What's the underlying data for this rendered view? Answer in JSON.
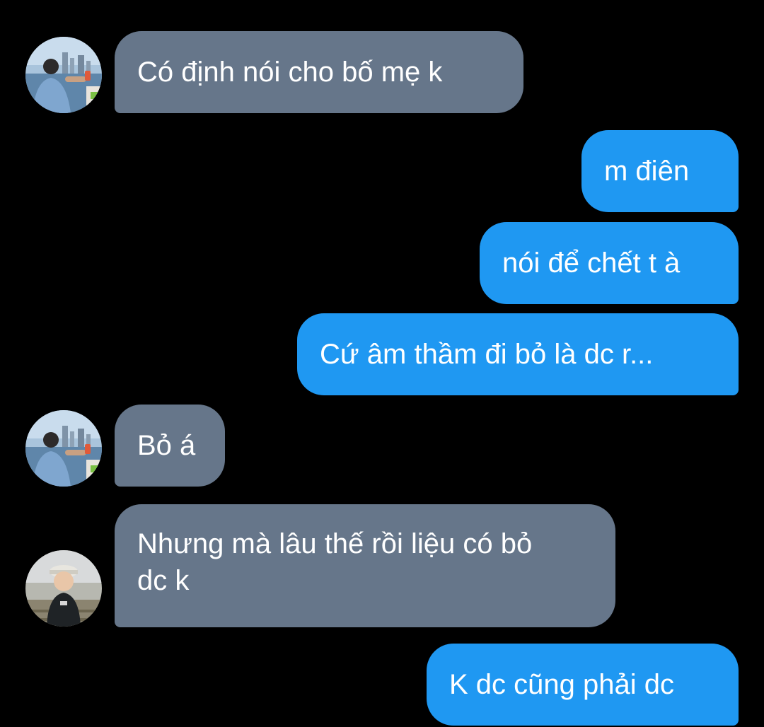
{
  "conversation": {
    "messages": [
      {
        "side": "received",
        "text": "Có định nói cho bố mẹ k",
        "avatar": "avatar-photo-man-waterfront"
      },
      {
        "side": "sent",
        "text": "m điên"
      },
      {
        "side": "sent",
        "text": "nói để chết t à"
      },
      {
        "side": "sent",
        "text": "Cứ âm thầm đi bỏ là dc r..."
      },
      {
        "side": "received",
        "text": "Bỏ á",
        "avatar": "avatar-photo-man-waterfront"
      },
      {
        "side": "received",
        "text": "Nhưng mà lâu thế rồi liệu có bỏ dc k",
        "avatar": "avatar-photo-child-cap"
      },
      {
        "side": "sent",
        "text": "K dc cũng phải dc"
      }
    ]
  },
  "colors": {
    "background": "#000000",
    "received_bubble": "#66768a",
    "sent_bubble": "#1f98f2",
    "text": "#ffffff"
  }
}
